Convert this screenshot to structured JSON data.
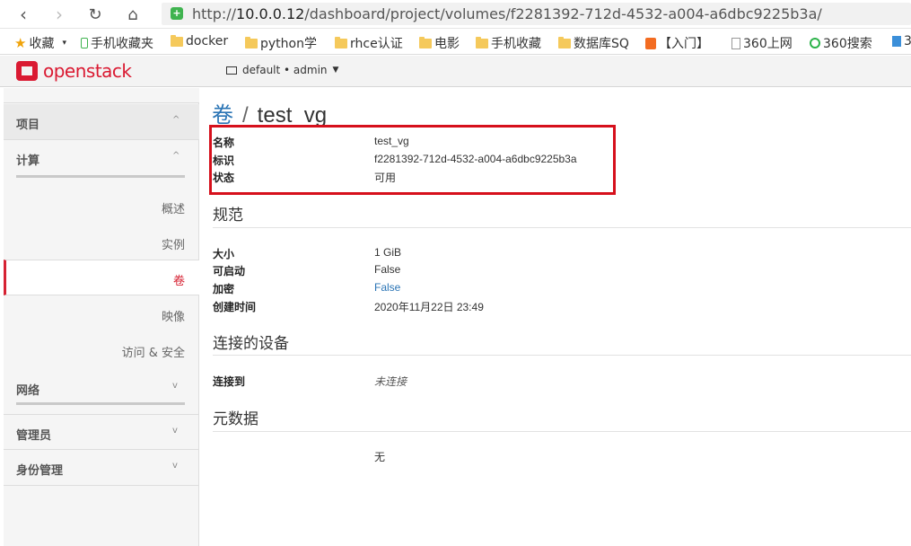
{
  "browser": {
    "url_prefix": "http://",
    "url_host": "10.0.0.12",
    "url_path": "/dashboard/project/volumes/f2281392-712d-4532-a004-a6dbc9225b3a/"
  },
  "bookmarks": [
    {
      "label": "收藏",
      "icon": "star"
    },
    {
      "label": "手机收藏夹",
      "icon": "phone"
    },
    {
      "label": "docker",
      "icon": "folder"
    },
    {
      "label": "python学",
      "icon": "folder"
    },
    {
      "label": "rhce认证",
      "icon": "folder"
    },
    {
      "label": "电影",
      "icon": "folder"
    },
    {
      "label": "手机收藏",
      "icon": "folder"
    },
    {
      "label": "数据库SQ",
      "icon": "folder"
    },
    {
      "label": "【入门】",
      "icon": "tag"
    },
    {
      "label": "360上网",
      "icon": "doc"
    },
    {
      "label": "360搜索",
      "icon": "ring"
    },
    {
      "label": "3",
      "icon": "shirt"
    }
  ],
  "header": {
    "logo_text": "openstack",
    "project_selector": "default • admin"
  },
  "sidebar": {
    "sections": [
      {
        "label": "项目",
        "chevron": "^"
      },
      {
        "label": "计算",
        "chevron": "^"
      },
      {
        "label": "网络",
        "chevron": "v"
      },
      {
        "label": "管理员",
        "chevron": "v"
      },
      {
        "label": "身份管理",
        "chevron": "v"
      }
    ],
    "items": [
      {
        "label": "概述"
      },
      {
        "label": "实例"
      },
      {
        "label": "卷"
      },
      {
        "label": "映像"
      },
      {
        "label": "访问 & 安全"
      }
    ]
  },
  "main": {
    "breadcrumb_link": "卷",
    "breadcrumb_sep": "/",
    "title": "test_vg",
    "overview": [
      {
        "key": "名称",
        "value": "test_vg"
      },
      {
        "key": "标识",
        "value": "f2281392-712d-4532-a004-a6dbc9225b3a"
      },
      {
        "key": "状态",
        "value": "可用"
      }
    ],
    "specs_title": "规范",
    "specs": [
      {
        "key": "大小",
        "value": "1 GiB"
      },
      {
        "key": "可启动",
        "value": "False"
      },
      {
        "key": "加密",
        "value": "False"
      },
      {
        "key": "创建时间",
        "value": "2020年11月22日 23:49"
      }
    ],
    "attachments_title": "连接的设备",
    "attachments_key": "连接到",
    "attachments_value": "未连接",
    "metadata_title": "元数据",
    "metadata_value": "无"
  },
  "colors": {
    "accent": "#d62233",
    "link": "#2a74b5",
    "highlight": "#d6101c"
  }
}
